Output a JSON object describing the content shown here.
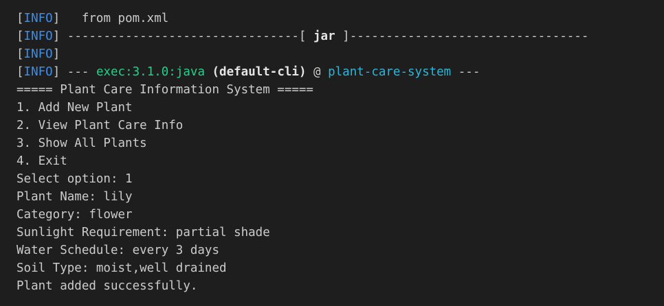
{
  "terminal": {
    "info_lines": [
      {
        "level": "INFO",
        "text": "   from pom.xml"
      },
      {
        "level": "INFO",
        "text": " --------------------------------[ ",
        "bold": "jar",
        "text_after": " ]---------------------------------"
      },
      {
        "level": "INFO",
        "text": ""
      },
      {
        "level": "INFO",
        "prefix": " --- ",
        "plugin": "exec:3.1.0:java",
        "execution": " (default-cli)",
        "at": " @ ",
        "project": "plant-care-system",
        "suffix": " ---"
      }
    ],
    "program_output": [
      "===== Plant Care Information System =====",
      "1. Add New Plant",
      "2. View Plant Care Info",
      "3. Show All Plants",
      "4. Exit",
      "Select option: 1",
      "Plant Name: lily",
      "Category: flower",
      "Sunlight Requirement: partial shade",
      "Water Schedule: every 3 days",
      "Soil Type: moist,well drained",
      "Plant added successfully."
    ]
  },
  "colors": {
    "background": "#1e1e1e",
    "foreground": "#cccccc",
    "info": "#3b8eea",
    "plugin": "#23d18b",
    "project": "#29b8db"
  }
}
